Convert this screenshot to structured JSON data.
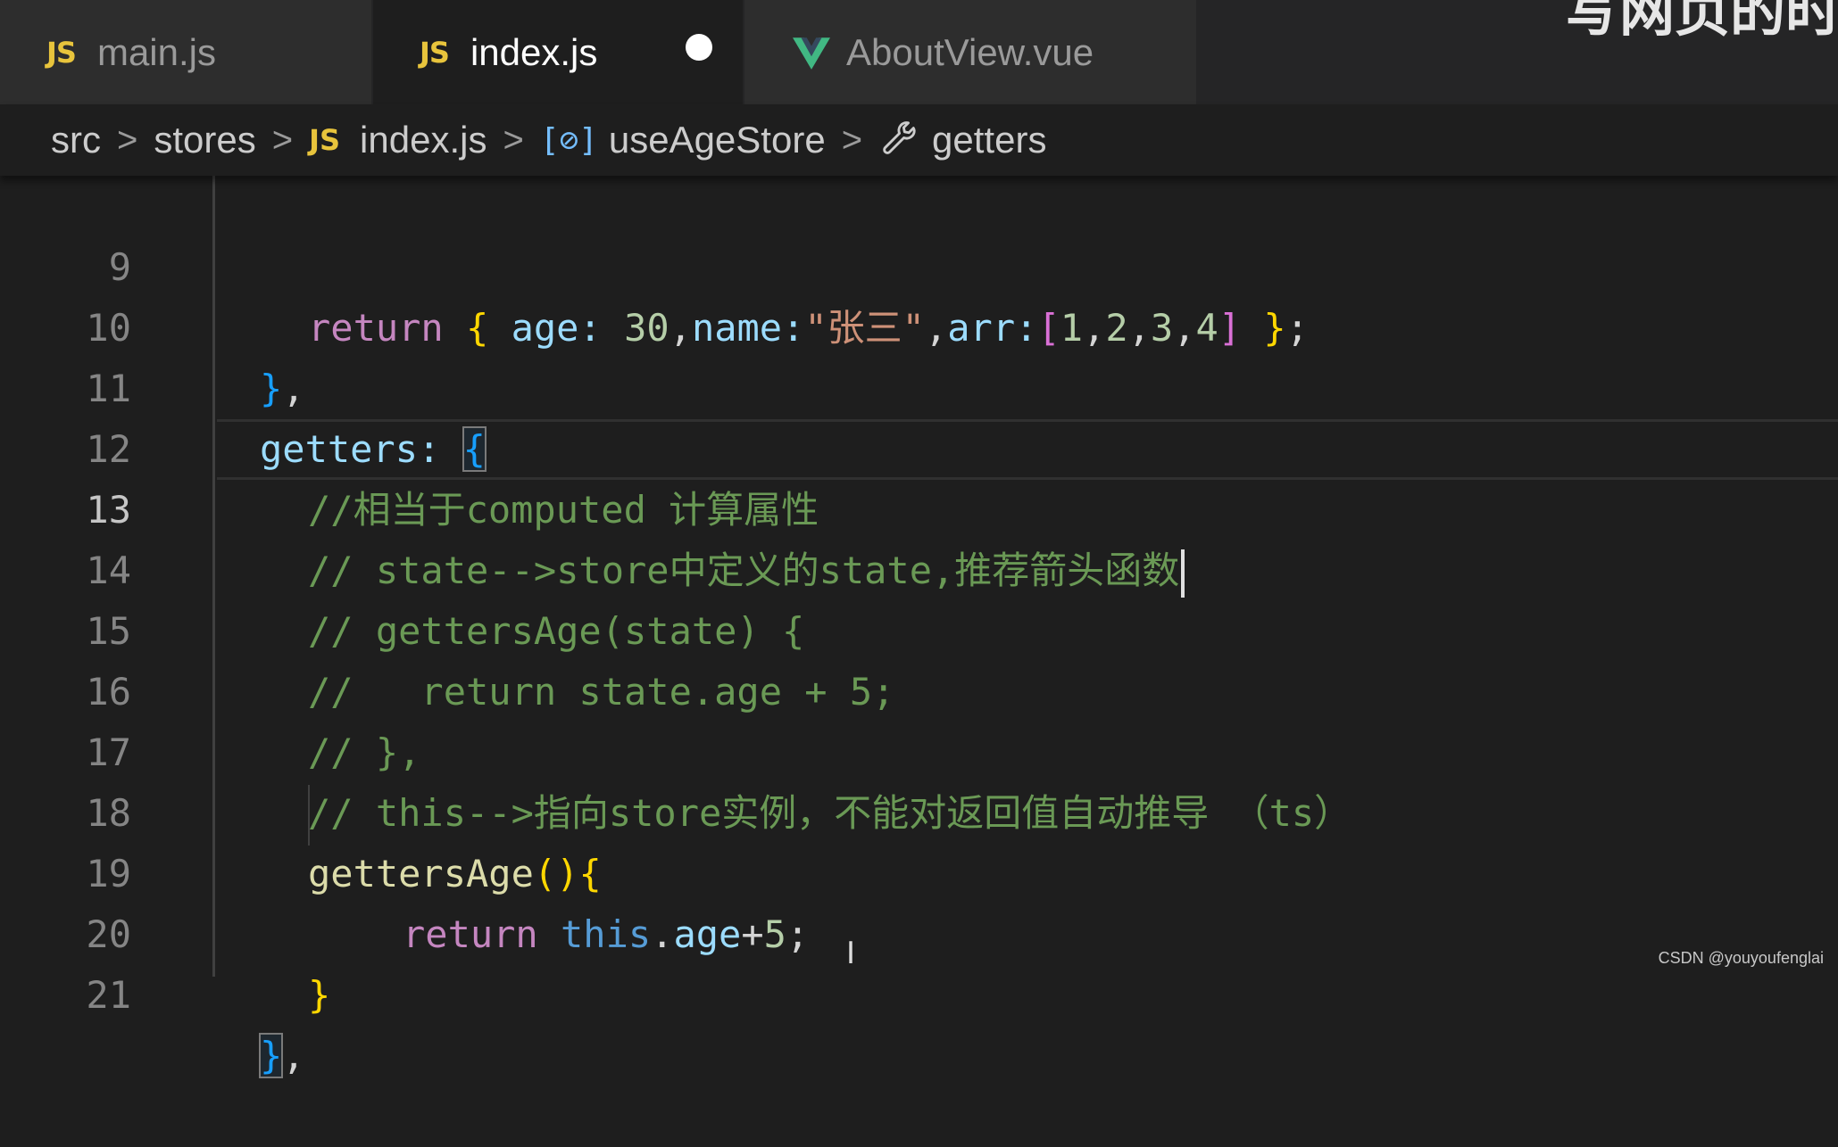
{
  "tabs": [
    {
      "icon": "js-icon",
      "icon_text": "JS",
      "label": "main.js",
      "active": false
    },
    {
      "icon": "js-icon",
      "icon_text": "JS",
      "label": "index.js",
      "active": true,
      "modified": true
    },
    {
      "icon": "vue-icon",
      "label": "AboutView.vue",
      "active": false
    }
  ],
  "overlay_text": "写网页的时",
  "breadcrumb": {
    "items": [
      {
        "label": "src"
      },
      {
        "label": "stores"
      },
      {
        "label": "index.js",
        "icon": "js-icon",
        "icon_text": "JS"
      },
      {
        "label": "useAgeStore",
        "icon": "symbol-variable-icon",
        "icon_text": "[⊘]"
      },
      {
        "label": "getters",
        "icon": "wrench-icon"
      }
    ],
    "separator": ">"
  },
  "editor": {
    "current_line": 13,
    "lines": [
      {
        "number": "9"
      },
      {
        "number": "10"
      },
      {
        "number": "11"
      },
      {
        "number": "12"
      },
      {
        "number": "13"
      },
      {
        "number": "14"
      },
      {
        "number": "15"
      },
      {
        "number": "16"
      },
      {
        "number": "17"
      },
      {
        "number": "18"
      },
      {
        "number": "19"
      },
      {
        "number": "20"
      },
      {
        "number": "21"
      }
    ],
    "tokens": {
      "l9": [
        "return",
        " ",
        "{",
        " ",
        "age",
        ":",
        " ",
        "30",
        ",",
        "name",
        ":",
        "\"张三\"",
        ",",
        "arr",
        ":",
        "[",
        "1",
        ",",
        "2",
        ",",
        "3",
        ",",
        "4",
        "]",
        " ",
        "}",
        ";"
      ],
      "l10": [
        "}",
        ","
      ],
      "l11": [
        "getters",
        ":",
        " ",
        "{"
      ],
      "l12": "//相当于computed 计算属性",
      "l13": "// state-->store中定义的state,推荐箭头函数",
      "l14": "// gettersAge(state) {",
      "l15": "//   return state.age + 5;",
      "l16": "// },",
      "l17": "// this-->指向store实例，不能对返回值自动推导 （ts）",
      "l18": [
        "gettersAge",
        "(",
        ")",
        "{"
      ],
      "l19": [
        "return",
        " ",
        "this",
        ".",
        "age",
        "+",
        "5",
        ";"
      ],
      "l20": [
        "}"
      ],
      "l21": [
        "}",
        ","
      ]
    }
  },
  "watermark": "CSDN @youyoufenglai",
  "colors": {
    "keyword": "#c586c0",
    "property": "#9cdcfe",
    "number": "#b5cea8",
    "string": "#ce9178",
    "comment": "#6a9955",
    "function": "#dcdcaa",
    "this": "#569cd6",
    "bracket1": "#ffd700",
    "bracket2": "#da70d6",
    "bracket3": "#179fff",
    "js_icon": "#e8c43c",
    "vue_icon": "#41b883"
  }
}
